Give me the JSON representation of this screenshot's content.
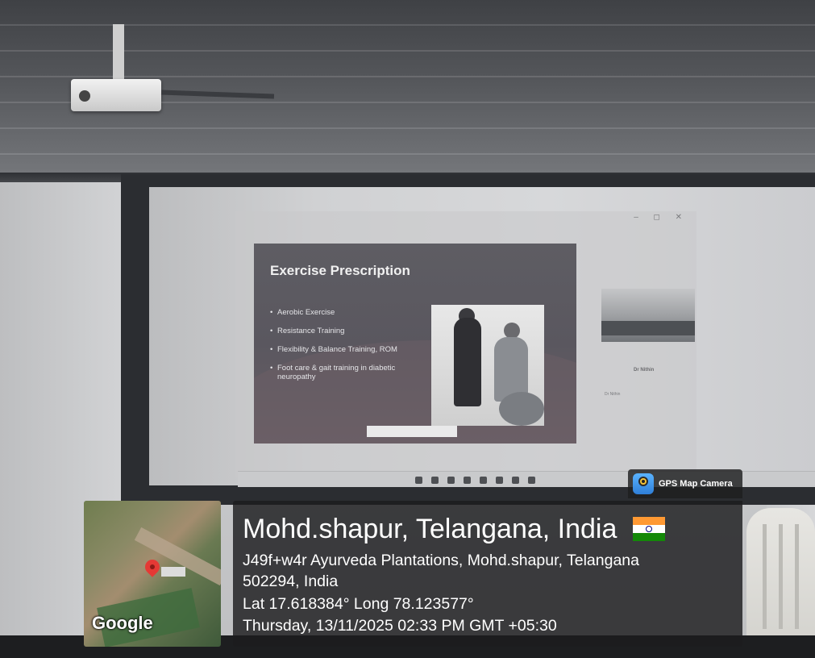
{
  "slide": {
    "title": "Exercise Prescription",
    "bullets": [
      "Aerobic Exercise",
      "Resistance Training",
      "Flexibility & Balance Training, ROM",
      "Foot care & gait training in diabetic neuropathy"
    ]
  },
  "window": {
    "controls": "– ◻ ✕"
  },
  "meeting": {
    "participant_name": "Dr Nithin",
    "participant_small": "Dr Nithin"
  },
  "gps": {
    "app_name": "GPS Map Camera",
    "map_brand": "Google",
    "location_title": "Mohd.shapur, Telangana, India",
    "address_line1": "J49f+w4r Ayurveda Plantations, Mohd.shapur, Telangana",
    "address_line2": "502294, India",
    "coordinates": "Lat 17.618384° Long 78.123577°",
    "datetime": "Thursday, 13/11/2025 02:33 PM GMT +05:30",
    "flag_colors": {
      "saffron": "#ff9933",
      "white": "#ffffff",
      "green": "#138808",
      "chakra": "#000080"
    }
  }
}
